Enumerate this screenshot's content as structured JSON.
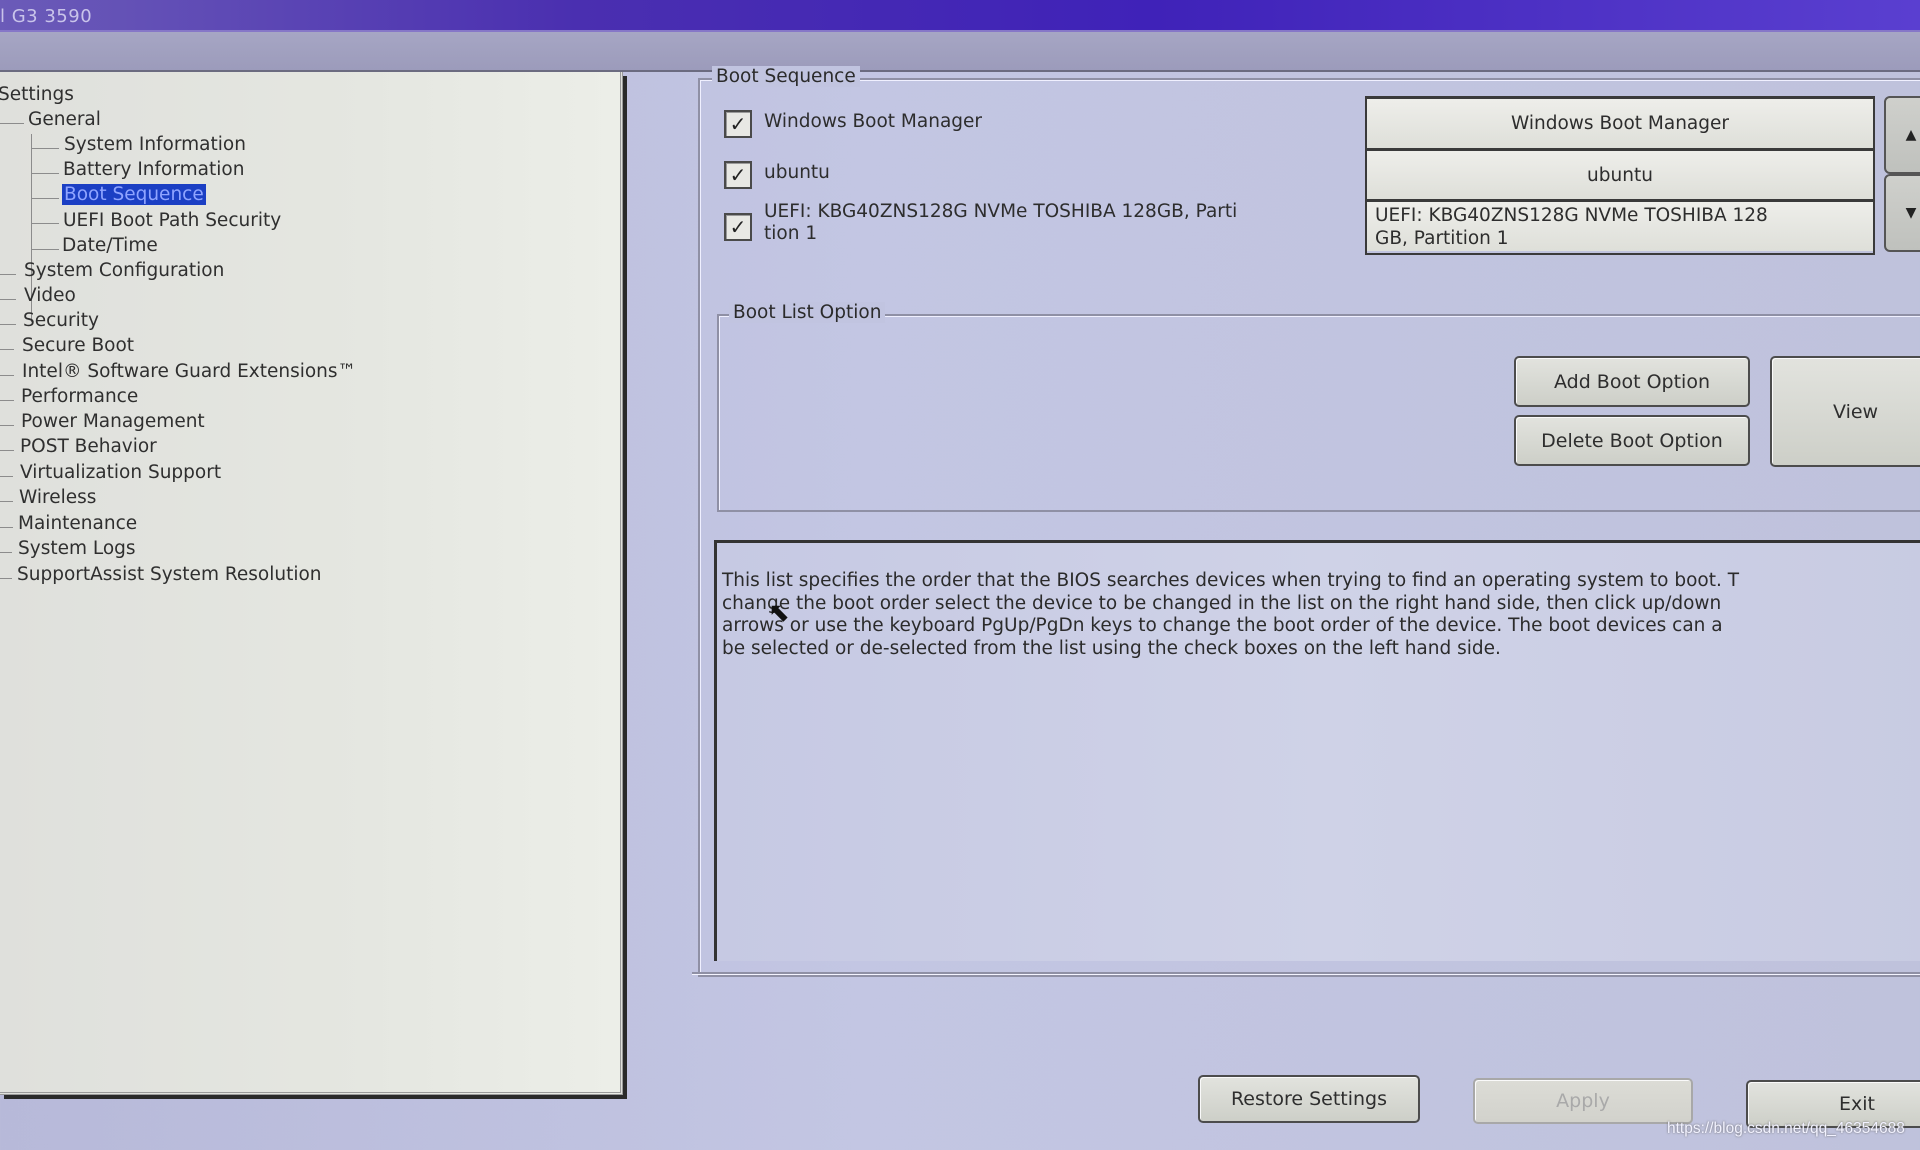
{
  "window": {
    "title": "l G3 3590"
  },
  "tree": {
    "root": "Settings",
    "items": [
      {
        "label": "General",
        "level": 1
      },
      {
        "label": "System Information",
        "level": 2
      },
      {
        "label": "Battery Information",
        "level": 2
      },
      {
        "label": "Boot Sequence",
        "level": 2,
        "selected": true
      },
      {
        "label": "UEFI Boot Path Security",
        "level": 2
      },
      {
        "label": "Date/Time",
        "level": 2
      },
      {
        "label": "System Configuration",
        "level": 1
      },
      {
        "label": "Video",
        "level": 1
      },
      {
        "label": "Security",
        "level": 1
      },
      {
        "label": "Secure Boot",
        "level": 1
      },
      {
        "label": "Intel® Software Guard Extensions™",
        "level": 1
      },
      {
        "label": "Performance",
        "level": 1
      },
      {
        "label": "Power Management",
        "level": 1
      },
      {
        "label": "POST Behavior",
        "level": 1
      },
      {
        "label": "Virtualization Support",
        "level": 1
      },
      {
        "label": "Wireless",
        "level": 1
      },
      {
        "label": "Maintenance",
        "level": 1
      },
      {
        "label": "System Logs",
        "level": 1
      },
      {
        "label": "SupportAssist System Resolution",
        "level": 1
      }
    ]
  },
  "boot_sequence": {
    "legend": "Boot Sequence",
    "checkboxes": [
      {
        "label": "Windows Boot Manager",
        "checked": true,
        "glyph": "✓"
      },
      {
        "label": "ubuntu",
        "checked": true,
        "glyph": "✓"
      },
      {
        "label": "UEFI: KBG40ZNS128G NVMe TOSHIBA 128GB, Parti\ntion 1",
        "checked": true,
        "glyph": "✓"
      }
    ],
    "order_list": [
      "Windows Boot Manager",
      "ubuntu",
      "UEFI: KBG40ZNS128G NVMe TOSHIBA 128\nGB, Partition 1"
    ],
    "move_up_icon": "▲",
    "move_down_icon": "▼"
  },
  "boot_list_option": {
    "legend": "Boot List Option",
    "add_label": "Add Boot Option",
    "delete_label": "Delete Boot Option",
    "view_label": "View"
  },
  "description": "This list specifies the order that the BIOS searches devices when trying to find an operating system to boot. T\nchange the boot order select the device to be changed in the list on the right hand side, then click up/down\narrows or use the keyboard PgUp/PgDn keys to change the boot order of the device. The boot devices can a\nbe selected or de-selected from the list using the check boxes on the left hand side.",
  "cursor_icon": "⬉",
  "footer": {
    "restore_label": "Restore Settings",
    "apply_label": "Apply",
    "apply_enabled": false,
    "exit_label": "Exit"
  },
  "watermark": "https://blog.csdn.net/qq_46354688",
  "colors": {
    "selection": "#1b3fc4",
    "titlebar": "#4a2fb0"
  }
}
